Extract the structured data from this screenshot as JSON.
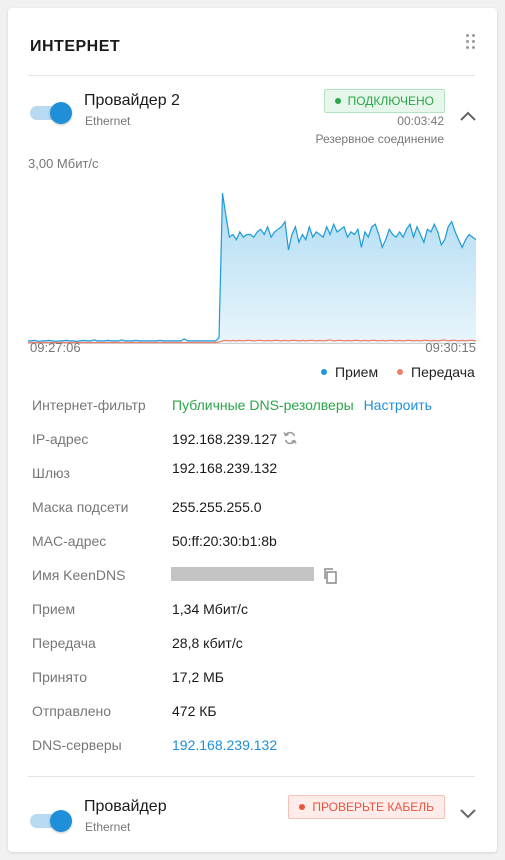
{
  "card": {
    "title": "ИНТЕРНЕТ"
  },
  "provider1": {
    "name": "Провайдер 2",
    "type": "Ethernet",
    "enabled": true,
    "status": "ПОДКЛЮЧЕНО",
    "uptime": "00:03:42",
    "role": "Резервное соединение"
  },
  "chart_data": {
    "type": "area",
    "ylabel": "3,00 Мбит/с",
    "x_start": "09:27:06",
    "x_end": "09:30:15",
    "ylim": [
      0,
      3.0
    ],
    "series": [
      {
        "name": "Прием",
        "color": "#1e9ad6",
        "values": [
          0.04,
          0.04,
          0.05,
          0.03,
          0.04,
          0.04,
          0.05,
          0.04,
          0.03,
          0.04,
          0.04,
          0.05,
          0.04,
          0.04,
          0.03,
          0.04,
          0.05,
          0.04,
          0.04,
          0.06,
          0.04,
          0.04,
          0.04,
          0.05,
          0.04,
          0.04,
          0.04,
          0.06,
          0.04,
          0.04,
          0.04,
          0.05,
          0.04,
          0.04,
          0.04,
          0.04,
          0.04,
          0.04,
          0.05,
          0.04,
          0.04,
          0.04,
          0.04,
          0.04,
          0.04,
          0.08,
          0.04,
          0.04,
          0.04,
          0.04,
          0.04,
          0.04,
          0.04,
          0.04,
          0.04,
          0.1,
          2.9,
          2.45,
          2.05,
          2.1,
          2.0,
          2.15,
          2.05,
          2.1,
          2.1,
          2.05,
          2.15,
          2.2,
          2.1,
          2.25,
          2.05,
          2.15,
          2.2,
          2.25,
          2.35,
          1.8,
          2.1,
          2.25,
          1.95,
          2.1,
          2.0,
          2.25,
          2.05,
          2.15,
          2.1,
          2.05,
          2.25,
          2.1,
          2.3,
          2.15,
          2.2,
          2.25,
          2.05,
          2.15,
          2.1,
          2.2,
          1.85,
          2.15,
          2.05,
          2.25,
          2.3,
          2.1,
          1.85,
          2.0,
          2.2,
          2.1,
          2.05,
          2.15,
          2.05,
          2.2,
          2.3,
          2.05,
          2.25,
          2.1,
          1.95,
          2.2,
          2.15,
          2.3,
          2.15,
          1.9,
          2.0,
          2.25,
          2.35,
          2.15,
          2.0,
          1.85,
          2.0,
          2.1,
          2.05,
          2.0
        ]
      },
      {
        "name": "Передача",
        "color": "#f07f6a",
        "values": [
          0.01,
          0.01,
          0.01,
          0.01,
          0.01,
          0.01,
          0.01,
          0.01,
          0.01,
          0.01,
          0.01,
          0.01,
          0.01,
          0.01,
          0.01,
          0.01,
          0.01,
          0.01,
          0.01,
          0.01,
          0.01,
          0.01,
          0.01,
          0.01,
          0.01,
          0.01,
          0.01,
          0.01,
          0.01,
          0.01,
          0.01,
          0.01,
          0.01,
          0.01,
          0.01,
          0.01,
          0.01,
          0.01,
          0.01,
          0.01,
          0.01,
          0.01,
          0.01,
          0.01,
          0.01,
          0.01,
          0.01,
          0.01,
          0.01,
          0.01,
          0.01,
          0.01,
          0.01,
          0.01,
          0.01,
          0.02,
          0.04,
          0.05,
          0.04,
          0.05,
          0.04,
          0.05,
          0.04,
          0.05,
          0.05,
          0.04,
          0.05,
          0.05,
          0.04,
          0.05,
          0.04,
          0.05,
          0.05,
          0.04,
          0.05,
          0.04,
          0.05,
          0.05,
          0.04,
          0.05,
          0.04,
          0.05,
          0.05,
          0.04,
          0.05,
          0.04,
          0.05,
          0.06,
          0.04,
          0.05,
          0.05,
          0.04,
          0.05,
          0.04,
          0.05,
          0.05,
          0.04,
          0.05,
          0.04,
          0.05,
          0.05,
          0.04,
          0.05,
          0.04,
          0.05,
          0.05,
          0.04,
          0.05,
          0.04,
          0.05,
          0.05,
          0.04,
          0.05,
          0.04,
          0.05,
          0.05,
          0.04,
          0.05,
          0.04,
          0.05,
          0.06,
          0.04,
          0.05,
          0.05,
          0.04,
          0.05,
          0.04,
          0.05,
          0.05,
          0.04
        ]
      }
    ]
  },
  "details": {
    "filter_label": "Интернет-фильтр",
    "filter_value": "Публичные DNS-резолверы",
    "filter_action": "Настроить",
    "ip_label": "IP-адрес",
    "ip_value": "192.168.239.127",
    "gateway_label": "Шлюз",
    "gateway_value": "192.168.239.132",
    "mask_label": "Маска подсети",
    "mask_value": "255.255.255.0",
    "mac_label": "MAC-адрес",
    "mac_value": "50:ff:20:30:b1:8b",
    "keendns_label": "Имя KeenDNS",
    "rx_rate_label": "Прием",
    "rx_rate_value": "1,34 Мбит/с",
    "tx_rate_label": "Передача",
    "tx_rate_value": "28,8 кбит/с",
    "rx_total_label": "Принято",
    "rx_total_value": "17,2 МБ",
    "tx_total_label": "Отправлено",
    "tx_total_value": "472 КБ",
    "dns_label": "DNS-серверы",
    "dns_value": "192.168.239.132"
  },
  "provider2": {
    "name": "Провайдер",
    "type": "Ethernet",
    "enabled": true,
    "status": "ПРОВЕРЬТЕ КАБЕЛЬ"
  },
  "icons": {
    "drag": "drag-handle-icon",
    "refresh": "refresh-icon",
    "copy": "copy-icon",
    "collapse": "chevron-up-icon",
    "expand": "chevron-down-icon"
  }
}
